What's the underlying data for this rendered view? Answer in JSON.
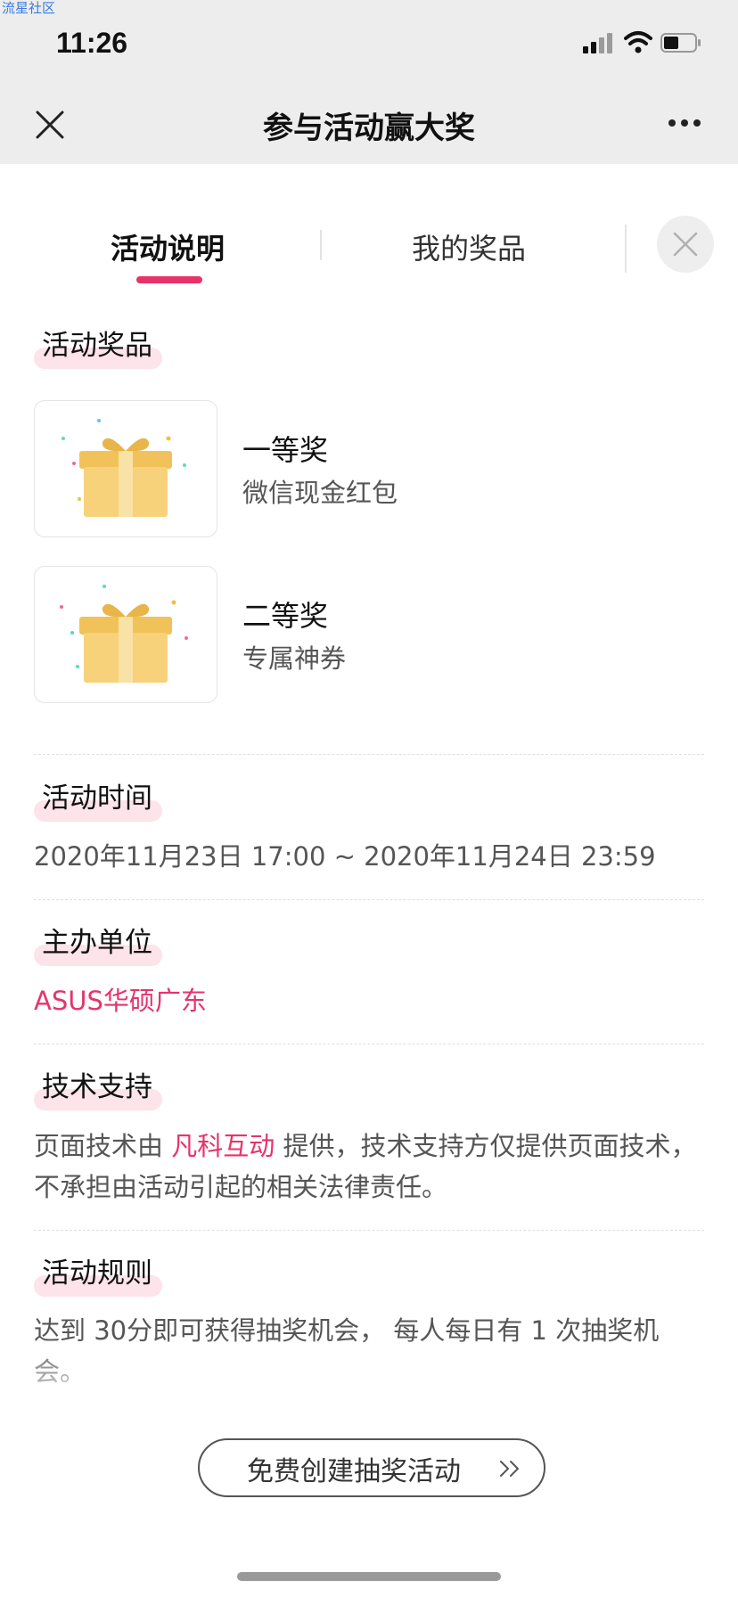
{
  "watermark": "流星社区",
  "status_bar": {
    "time": "11:26"
  },
  "nav": {
    "title": "参与活动赢大奖"
  },
  "tabs": [
    {
      "label": "活动说明",
      "active": true
    },
    {
      "label": "我的奖品",
      "active": false
    }
  ],
  "sections": {
    "prizes": {
      "title": "活动奖品",
      "items": [
        {
          "name": "一等奖",
          "desc": "微信现金红包",
          "icon": "gift-box-icon"
        },
        {
          "name": "二等奖",
          "desc": "专属神券",
          "icon": "gift-box-icon"
        }
      ]
    },
    "time": {
      "title": "活动时间",
      "value": "2020年11月23日 17:00 ~ 2020年11月24日 23:59"
    },
    "organizer": {
      "title": "主办单位",
      "value": "ASUS华硕广东"
    },
    "tech_support": {
      "title": "技术支持",
      "prefix": "页面技术由 ",
      "provider": "凡科互动",
      "suffix": " 提供，技术支持方仅提供页面技术，不承担由活动引起的相关法律责任。"
    },
    "rules": {
      "title": "活动规则",
      "value": "达到 30分即可获得抽奖机会， 每人每日有 1 次抽奖机会。"
    }
  },
  "cta": {
    "label": "免费创建抽奖活动"
  },
  "colors": {
    "accent": "#e8336a",
    "nav_bg": "#ededed",
    "highlight": "#fde3ea"
  }
}
